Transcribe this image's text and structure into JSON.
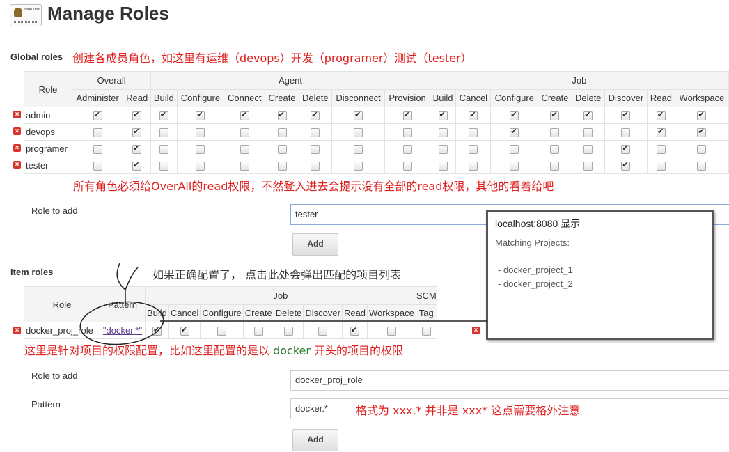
{
  "page": {
    "title": "Manage Roles",
    "logo_text": "John Doe"
  },
  "global": {
    "heading": "Global roles",
    "note": "创建各成员角色，如这里有运维（devops）开发（programer）测试（tester）",
    "groups": [
      "Overall",
      "Agent",
      "Job"
    ],
    "role_header": "Role",
    "columns": [
      "Administer",
      "Read",
      "Build",
      "Configure",
      "Connect",
      "Create",
      "Delete",
      "Disconnect",
      "Provision",
      "Build",
      "Cancel",
      "Configure",
      "Create",
      "Delete",
      "Discover",
      "Read",
      "Workspace"
    ],
    "rows": [
      {
        "name": "admin",
        "checks": [
          1,
          1,
          1,
          1,
          1,
          1,
          1,
          1,
          1,
          1,
          1,
          1,
          1,
          1,
          1,
          1,
          1
        ]
      },
      {
        "name": "devops",
        "checks": [
          0,
          1,
          0,
          0,
          0,
          0,
          0,
          0,
          0,
          0,
          0,
          1,
          0,
          0,
          0,
          1,
          1
        ]
      },
      {
        "name": "programer",
        "checks": [
          0,
          1,
          0,
          0,
          0,
          0,
          0,
          0,
          0,
          0,
          0,
          0,
          0,
          0,
          1,
          0,
          0
        ]
      },
      {
        "name": "tester",
        "checks": [
          0,
          1,
          0,
          0,
          0,
          0,
          0,
          0,
          0,
          0,
          0,
          0,
          0,
          0,
          1,
          0,
          0
        ]
      }
    ],
    "note2": "所有角色必须给OverAll的read权限，不然登入进去会提示没有全部的read权限，其他的看着给吧",
    "role_to_add_label": "Role to add",
    "role_to_add_value": "tester",
    "add_button": "Add"
  },
  "popup": {
    "host": "localhost:8080 显示",
    "heading": "Matching Projects:",
    "items": [
      "- docker_project_1",
      "- docker_project_2"
    ]
  },
  "item": {
    "heading": "Item roles",
    "note": "如果正确配置了， 点击此处会弹出匹配的项目列表",
    "role_header": "Role",
    "pattern_header": "Pattern",
    "job_group": "Job",
    "scm_group": "SCM",
    "columns": [
      "Build",
      "Cancel",
      "Configure",
      "Create",
      "Delete",
      "Discover",
      "Read",
      "Workspace",
      "Tag"
    ],
    "rows": [
      {
        "name": "docker_proj_role",
        "pattern": "\"docker.*\"",
        "checks": [
          1,
          1,
          0,
          0,
          0,
          0,
          1,
          0,
          0
        ]
      }
    ],
    "note2_a": "这里是针对项目的权限配置，比如这里配置的是以 ",
    "note2_b": "docker",
    "note2_c": " 开头的项目的权限",
    "role_to_add_label": "Role to add",
    "role_to_add_value": "docker_proj_role",
    "pattern_label": "Pattern",
    "pattern_value": "docker.*",
    "pattern_note": "格式为 xxx.*  并非是  xxx*  这点需要格外注意",
    "add_button": "Add"
  }
}
